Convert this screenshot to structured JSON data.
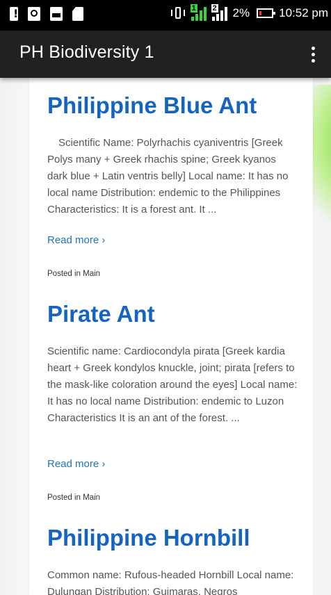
{
  "status_bar": {
    "battery_percent": "2%",
    "time": "10:52 pm",
    "left_icons": [
      "battery-alert-icon",
      "usb-debug-icon",
      "gallery-icon",
      "sdcard-icon"
    ],
    "right_icons": [
      "vibrate-icon",
      "signal-sim1-icon",
      "signal-sim2-icon",
      "battery-low-icon"
    ],
    "sim1_label": "1",
    "sim2_label": "2"
  },
  "app_bar": {
    "title": "PH Biodiversity 1",
    "menu_icon": "overflow-menu-icon"
  },
  "posts": [
    {
      "title": "Philippine Blue Ant",
      "excerpt": "Scientific Name: Polyrhachis cyaniventris [Greek Polys many + Greek rhachis spine; Greek kyanos dark blue + Latin ventris belly] Local name: It has no local name Distribution: endemic to the Philippines Characteristics: It is a forest ant. It  ...",
      "read_more": "Read more ›",
      "posted_in": "Posted in Main"
    },
    {
      "title": "Pirate Ant",
      "excerpt": "Scientific name: Cardiocondyla pirata [Greek kardia heart + Greek kondylos knuckle, joint; pirata [refers to the mask-like coloration around the eyes] Local name: It has no local name Distribution: endemic to Luzon Characteristics It is an ant of the forest.  ...",
      "read_more": "Read more ›",
      "posted_in": "Posted in Main"
    },
    {
      "title": "Philippine Hornbill",
      "excerpt": "Common name: Rufous-headed Hornbill Local name:  Dulungan Distribution: Guimaras, Negros"
    }
  ],
  "colors": {
    "status_bar_bg": "#000000",
    "app_bar_bg": "#212121",
    "title_blue": "#1565c0",
    "link_blue": "#1e73be",
    "body_text": "#555555"
  }
}
